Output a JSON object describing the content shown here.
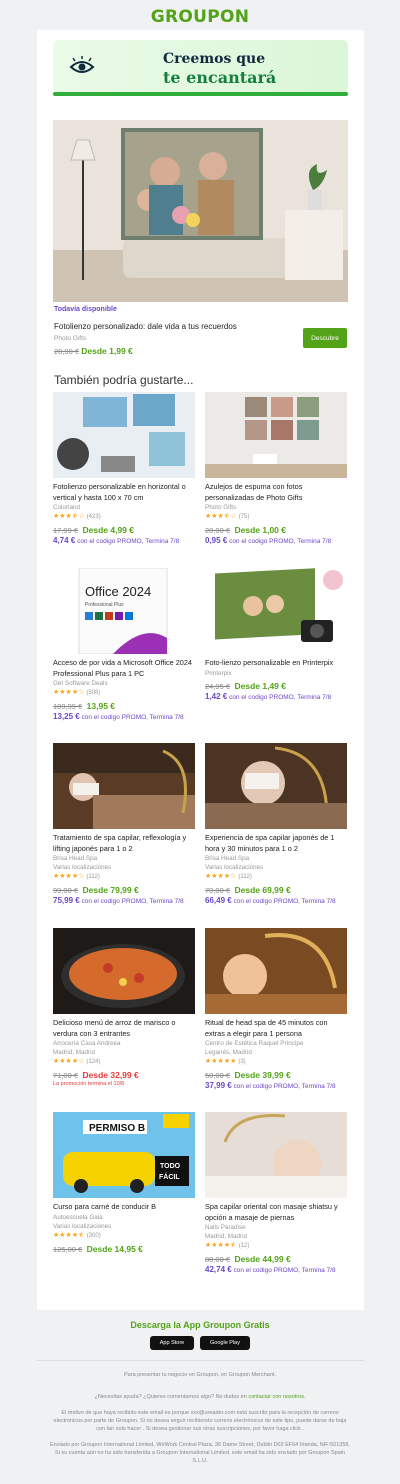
{
  "brand": "GROUPON",
  "banner": {
    "line1": "Creemos que",
    "line2": "te encantará"
  },
  "hero": {
    "availability": "Todavía disponible",
    "title": "Fotolienzo personalizado: dale vida a tus recuerdos",
    "merchant": "Photo Gifts",
    "old_price": "28,90 €",
    "new_price": "Desde 1,99 €",
    "button": "Descubre"
  },
  "also_title": "También podría gustarte...",
  "deals": [
    {
      "title": "Fotolienzo personalizable en horizontal o vertical y hasta 100 x 70 cm",
      "merchant": "Colorland",
      "location": "",
      "rating": 3.5,
      "reviews": "(423)",
      "old_price": "17,99 €",
      "new_price": "Desde 4,99 €",
      "promo_price": "4,74 €",
      "promo_text": "con el codigo PROMO, Termina 7/8",
      "img_label": "colorland"
    },
    {
      "title": "Azulejos de espuma con fotos personalizadas de Photo Gifts",
      "merchant": "Photo Gifts",
      "location": "",
      "rating": 3.5,
      "reviews": "(75)",
      "old_price": "20,00 €",
      "new_price": "Desde 1,00 €",
      "promo_price": "0,95 €",
      "promo_text": "con el codigo PROMO, Termina 7/8",
      "img_label": ""
    },
    {
      "title": "Acceso de por vida a Microsoft Office 2024 Professional Plus para 1 PC",
      "merchant": "Get Software Deals",
      "location": "",
      "rating": 4,
      "reviews": "(508)",
      "old_price": "109,99 €",
      "new_price": "13,95 €",
      "promo_price": "13,25 €",
      "promo_text": "con el codigo PROMO, Termina 7/8",
      "img_label": "Office 2024"
    },
    {
      "title": "Foto-lienzo personalizable en Printerpix",
      "merchant": "Printerpix",
      "location": "",
      "rating": 0,
      "reviews": "",
      "old_price": "24,95 €",
      "new_price": "Desde 1,49 €",
      "promo_price": "1,42 €",
      "promo_text": "con el codigo PROMO, Termina 7/8",
      "img_label": ""
    },
    {
      "title": "Tratamiento de spa capilar, reflexología y lifting japonés para 1 o 2",
      "merchant": "Brisa Head Spa",
      "location": "Varias localizaciones",
      "rating": 4,
      "reviews": "(112)",
      "old_price": "99,00 €",
      "new_price": "Desde 79,99 €",
      "promo_price": "75,99 €",
      "promo_text": "con el codigo PROMO, Termina 7/8",
      "img_label": ""
    },
    {
      "title": "Experiencia de spa capilar japonés de 1 hora y 30 minutos para 1 o 2",
      "merchant": "Brisa Head Spa",
      "location": "Varias localizaciones",
      "rating": 4,
      "reviews": "(112)",
      "old_price": "79,00 €",
      "new_price": "Desde 69,99 €",
      "promo_price": "66,49 €",
      "promo_text": "con el codigo PROMO, Termina 7/8",
      "img_label": ""
    },
    {
      "title": "Delicioso menú de arroz de marisco o verdura con 3 entrantes",
      "merchant": "Arrocería Casa Andreea",
      "location": "Madrid, Madrid",
      "rating": 4,
      "reviews": "(124)",
      "old_price": "71,00 €",
      "new_price": "Desde 32,99 €",
      "promo_price": "",
      "promo_text": "La promoción termina el 10/8",
      "img_label": ""
    },
    {
      "title": "Ritual de head spa de 45 minutos con extras a elegir para 1 persona",
      "merchant": "Centro de Estética Raquel Príncipe",
      "location": "Leganés, Madrid",
      "rating": 5,
      "reviews": "(3)",
      "old_price": "50,00 €",
      "new_price": "Desde 39,99 €",
      "promo_price": "37,99 €",
      "promo_text": "con el codigo PROMO, Termina 7/8",
      "img_label": ""
    },
    {
      "title": "Curso para carné de conducir B",
      "merchant": "Autoescuela Gala",
      "location": "Varias localizaciones",
      "rating": 4.5,
      "reviews": "(300)",
      "old_price": "125,00 €",
      "new_price": "Desde 14,95 €",
      "promo_price": "",
      "promo_text": "",
      "img_label": "PERMISO B"
    },
    {
      "title": "Spa capilar oriental con masaje shiatsu y opción a masaje de piernas",
      "merchant": "Nails Paradise",
      "location": "Madrid, Madrid",
      "rating": 4.5,
      "reviews": "(12)",
      "old_price": "80,00 €",
      "new_price": "Desde 44,99 €",
      "promo_price": "42,74 €",
      "promo_text": "con el codigo PROMO, Termina 7/8",
      "img_label": ""
    }
  ],
  "app": {
    "title": "Descarga la App Groupon Gratis",
    "appstore": "App Store",
    "googleplay": "Google Play"
  },
  "footer": {
    "merchant": "Para presentar tu negocio en Groupon, en Groupon Merchant.",
    "help": "¿Necesitas ayuda? ¿Quieres comentarnos algo? No dudes en",
    "help_link": "contactar con nosotros.",
    "reason": "El motivo de que haya recibido este email es porque xxx@ureader.com está suscrito para la recepción de correos electrónicos por parte de Groupon. Si no desea seguir recibiendo correos electrónicos de este tipo, puede darse de baja con tan solo hacer . Si desea gestionar sus otras suscripciones, por favor haga click .",
    "sent": "Enviado por Groupon International Limited, WeWork Central Plaza, 36 Dame Street, Dublin D02 EF64 Irlanda, NIF:501358. Si su cuenta aún no ha sido transferida a Groupon International Limited, este email ha sido enviado por Groupon Spain S.L.U."
  }
}
